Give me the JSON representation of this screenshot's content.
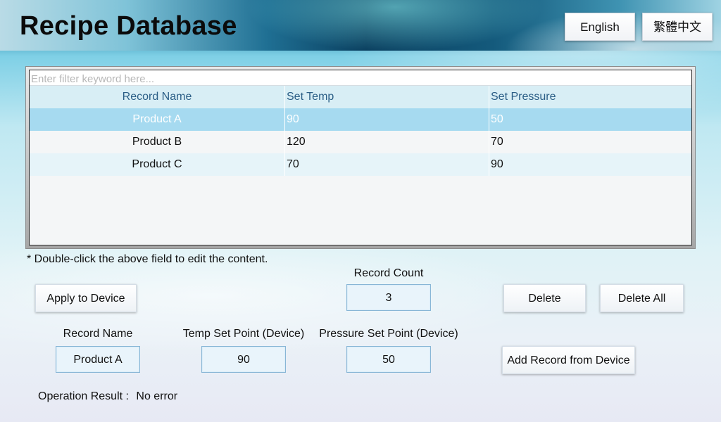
{
  "header": {
    "title": "Recipe Database",
    "lang_en": "English",
    "lang_zh": "繁體中文"
  },
  "table": {
    "filter_placeholder": "Enter filter keyword here...",
    "columns": [
      "Record Name",
      "Set Temp",
      "Set Pressure"
    ],
    "rows": [
      {
        "name": "Product A",
        "temp": "90",
        "pressure": "50",
        "selected": true
      },
      {
        "name": "Product B",
        "temp": "120",
        "pressure": "70",
        "selected": false
      },
      {
        "name": "Product C",
        "temp": "70",
        "pressure": "90",
        "selected": false
      }
    ]
  },
  "note": "* Double-click the above field to edit the content.",
  "record_count": {
    "label": "Record Count",
    "value": "3"
  },
  "buttons": {
    "apply": "Apply to Device",
    "delete": "Delete",
    "delete_all": "Delete All",
    "add_from_device": "Add Record from Device"
  },
  "device_fields": {
    "record_name_label": "Record Name",
    "record_name_value": "Product A",
    "temp_label": "Temp Set Point (Device)",
    "temp_value": "90",
    "pressure_label": "Pressure Set Point (Device)",
    "pressure_value": "50"
  },
  "operation": {
    "label": "Operation Result :",
    "value": "No error"
  },
  "colors": {
    "selected_row": "#a6daf0",
    "header_text": "#2b5e86",
    "field_bg": "#e9f4fb"
  }
}
